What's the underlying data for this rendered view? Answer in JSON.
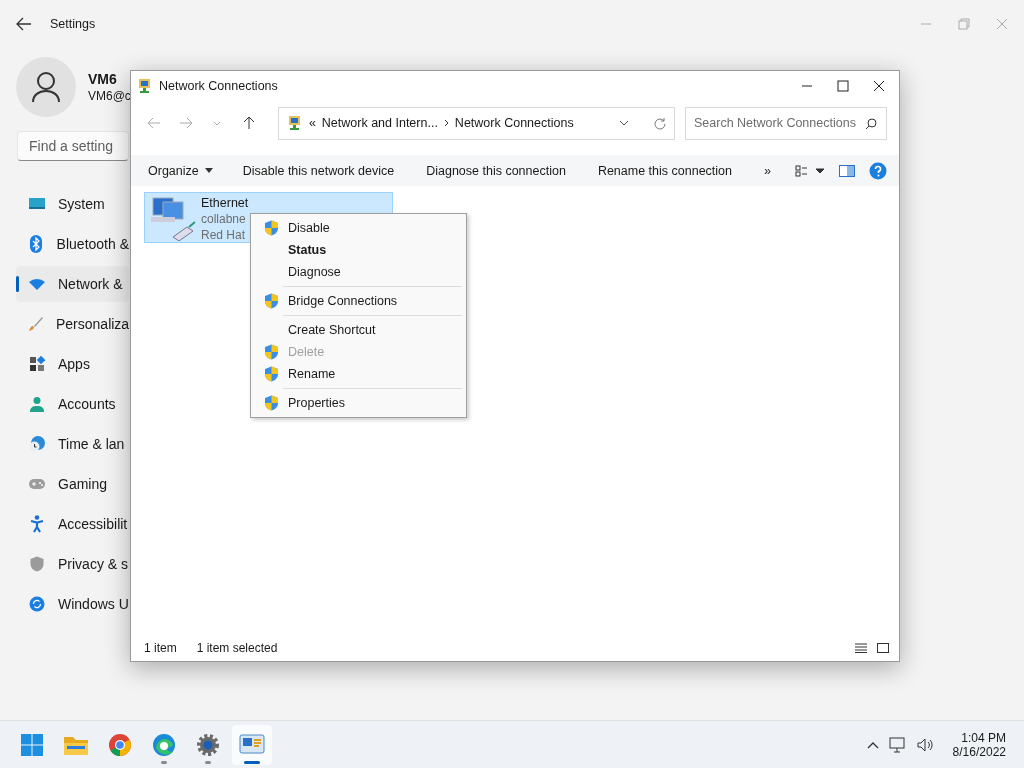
{
  "settings": {
    "title": "Settings",
    "user": {
      "name": "VM6",
      "email": "VM6@c"
    },
    "search": {
      "placeholder": "Find a setting"
    },
    "nav": [
      {
        "kind": "system",
        "label": "System",
        "selected": false
      },
      {
        "kind": "bluetooth",
        "label": "Bluetooth &",
        "selected": false
      },
      {
        "kind": "network",
        "label": "Network &",
        "selected": true
      },
      {
        "kind": "brush",
        "label": "Personaliza",
        "selected": false
      },
      {
        "kind": "apps",
        "label": "Apps",
        "selected": false
      },
      {
        "kind": "accounts",
        "label": "Accounts",
        "selected": false
      },
      {
        "kind": "time",
        "label": "Time & lan",
        "selected": false
      },
      {
        "kind": "gaming",
        "label": "Gaming",
        "selected": false
      },
      {
        "kind": "accessibility",
        "label": "Accessibilit",
        "selected": false
      },
      {
        "kind": "privacy",
        "label": "Privacy & s",
        "selected": false
      },
      {
        "kind": "update",
        "label": "Windows U",
        "selected": false
      }
    ]
  },
  "network_window": {
    "title": "Network Connections",
    "address": {
      "prefix": "«",
      "crumbs": [
        "Network and Intern...",
        "Network Connections"
      ]
    },
    "search": {
      "placeholder": "Search Network Connections"
    },
    "toolbar": [
      {
        "label": "Organize",
        "dropdown": true
      },
      {
        "label": "Disable this network device",
        "dropdown": false
      },
      {
        "label": "Diagnose this connection",
        "dropdown": false
      },
      {
        "label": "Rename this connection",
        "dropdown": false
      }
    ],
    "more": "»",
    "items": [
      {
        "name": "Ethernet",
        "lines": [
          "collabne",
          "Red Hat"
        ],
        "selected": true
      }
    ],
    "status_bar": [
      "1 item",
      "1 item selected"
    ]
  },
  "context_menu": {
    "groups": [
      [
        {
          "label": "Disable",
          "shield": true,
          "bold": false,
          "disabled": false
        },
        {
          "label": "Status",
          "shield": false,
          "bold": true,
          "disabled": false
        },
        {
          "label": "Diagnose",
          "shield": false,
          "bold": false,
          "disabled": false
        }
      ],
      [
        {
          "label": "Bridge Connections",
          "shield": true,
          "bold": false,
          "disabled": false
        }
      ],
      [
        {
          "label": "Create Shortcut",
          "shield": false,
          "bold": false,
          "disabled": false
        },
        {
          "label": "Delete",
          "shield": true,
          "bold": false,
          "disabled": true
        },
        {
          "label": "Rename",
          "shield": true,
          "bold": false,
          "disabled": false
        }
      ],
      [
        {
          "label": "Properties",
          "shield": true,
          "bold": false,
          "disabled": false
        }
      ]
    ]
  },
  "taskbar": {
    "apps": [
      {
        "kind": "start",
        "active": false
      },
      {
        "kind": "folder",
        "active": false
      },
      {
        "kind": "browser",
        "active": false
      },
      {
        "kind": "edge",
        "active": false
      },
      {
        "kind": "gear",
        "active": false
      },
      {
        "kind": "netpanel",
        "active": true
      }
    ],
    "time": "1:04 PM",
    "date": "8/16/2022"
  }
}
